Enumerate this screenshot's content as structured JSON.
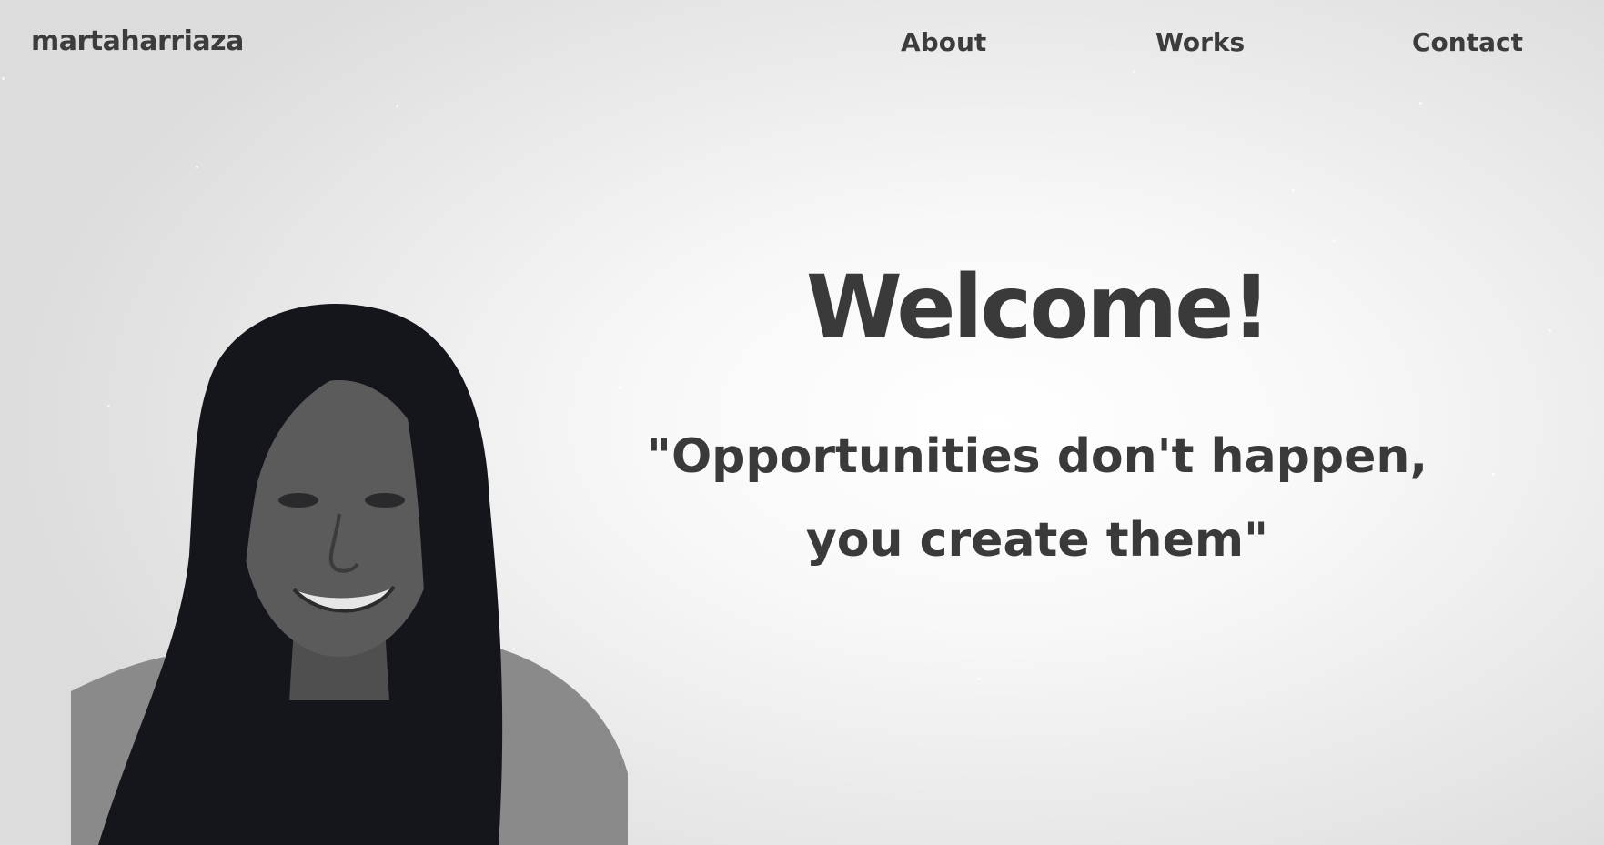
{
  "brand": {
    "name": "martaharriaza"
  },
  "nav": {
    "items": [
      {
        "label": "About"
      },
      {
        "label": "Works"
      },
      {
        "label": "Contact"
      }
    ]
  },
  "hero": {
    "title": "Welcome!",
    "quote_line1": "\"Opportunities don't happen,",
    "quote_line2": "you create them\""
  },
  "portrait": {
    "subject": "profile-photo"
  },
  "colors": {
    "text": "#3a3a3a",
    "background_center": "#ffffff",
    "background_edge": "#dcdcdc",
    "hair": "#14161c"
  }
}
